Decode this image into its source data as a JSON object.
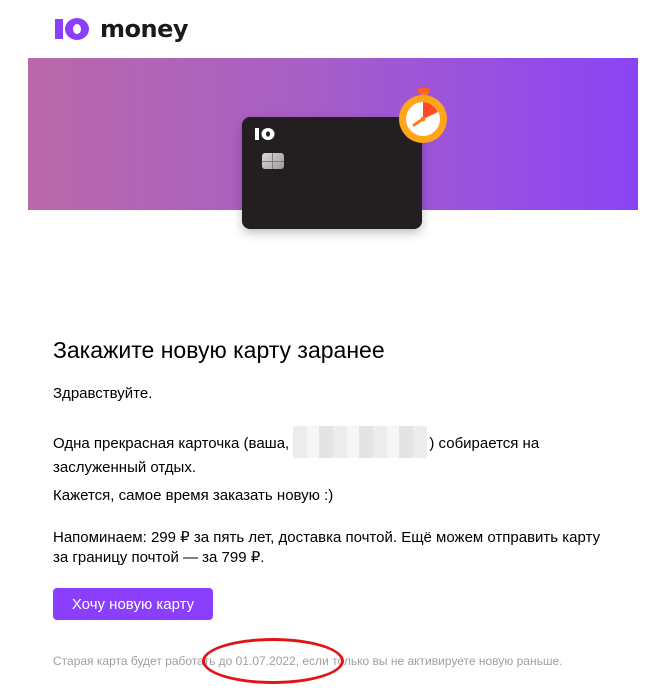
{
  "brand": {
    "name": "money",
    "accent": "#8b3ffc"
  },
  "banner": {
    "gradient_start": "#b968a9",
    "gradient_end": "#8b44f5"
  },
  "email": {
    "title": "Закажите новую карту заранее",
    "greeting": "Здравствуйте.",
    "card_text_before": "Одна прекрасная карточка (ваша,",
    "card_text_after": ") собирается на заслуженный отдых.",
    "new_card_text": "Кажется, самое время заказать новую :)",
    "reminder_text": "Напоминаем: 299 ₽ за пять лет, доставка почтой. Ещё можем отправить карту за границу почтой — за 799 ₽.",
    "button_label": "Хочу новую карту",
    "footer_text": "Старая карта будет работать до 01.07.2022, если только вы не активируете новую раньше."
  },
  "annotation": {
    "color": "#e11414"
  }
}
